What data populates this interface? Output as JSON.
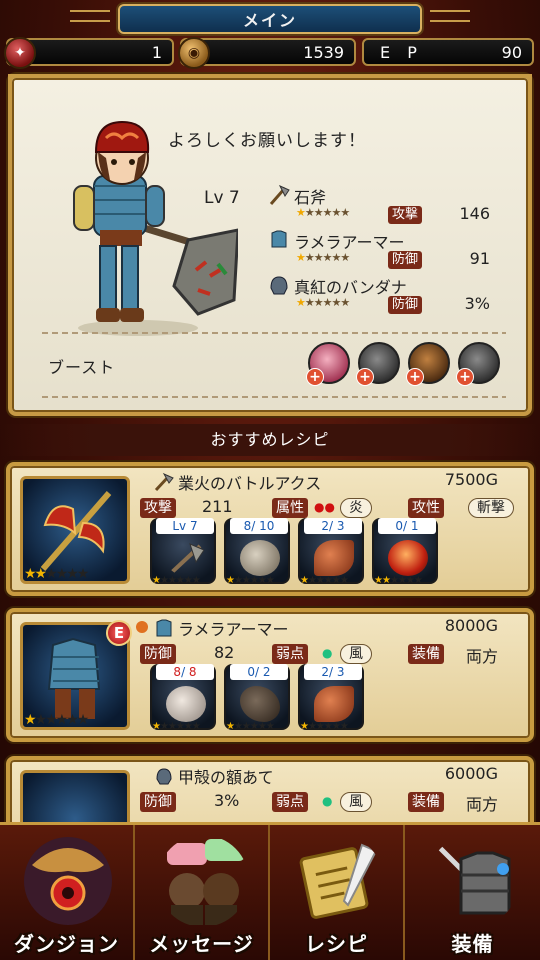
{
  "title": "メイン",
  "resources": {
    "stamina": "1",
    "gold": "1539",
    "ep_label": "E P",
    "ep": "90"
  },
  "character": {
    "greeting": "よろしくお願いします！",
    "level": "Lv  7",
    "equipment": [
      {
        "name": "石斧",
        "stat_label": "攻撃",
        "stat_value": "146",
        "rarity": 1,
        "max_rarity": 6,
        "icon": "axe-icon"
      },
      {
        "name": "ラメラアーマー",
        "stat_label": "防御",
        "stat_value": "91",
        "rarity": 1,
        "max_rarity": 6,
        "icon": "armor-icon"
      },
      {
        "name": "真紅のバンダナ",
        "stat_label": "防御",
        "stat_value": "3%",
        "rarity": 1,
        "max_rarity": 6,
        "icon": "helmet-icon"
      }
    ],
    "boost_label": "ブースト"
  },
  "section_title": "おすすめレシピ",
  "recipes": [
    {
      "name": "業火のバトルアクス",
      "price": "7500G",
      "stat_label": "攻撃",
      "stat_value": "211",
      "attr_label": "属性",
      "attr_value": "炎",
      "extra_label": "攻性",
      "extra_value": "斬撃",
      "rarity": 2,
      "materials": [
        {
          "count": "Lv 7",
          "type": "axe"
        },
        {
          "count": "8/ 10",
          "type": "rock"
        },
        {
          "count": "2/  3",
          "type": "claw"
        },
        {
          "count": "0/  1",
          "type": "orb"
        }
      ]
    },
    {
      "name": "ラメラアーマー",
      "price": "8000G",
      "stat_label": "防御",
      "stat_value": "82",
      "attr_label": "弱点",
      "attr_value": "風",
      "extra_label": "装備",
      "extra_value": "両方",
      "badge": "E",
      "rarity": 1,
      "materials": [
        {
          "have": "8",
          "need": "8",
          "type": "rock"
        },
        {
          "count": "0/  2",
          "type": "claw"
        },
        {
          "count": "2/  3",
          "type": "claw2"
        }
      ]
    },
    {
      "name": "甲殻の額あて",
      "price": "6000G",
      "stat_label": "防御",
      "stat_value": "3%",
      "attr_label": "弱点",
      "attr_value": "風",
      "extra_label": "装備",
      "extra_value": "両方"
    }
  ],
  "nav": [
    {
      "label": "ダンジョン",
      "icon": "dragon-icon"
    },
    {
      "label": "メッセージ",
      "icon": "chat-icon"
    },
    {
      "label": "レシピ",
      "icon": "scroll-icon"
    },
    {
      "label": "装備",
      "icon": "armor-icon"
    }
  ],
  "colors": {
    "frame_gold": "#c89b40",
    "tag_bg": "#7a2a18",
    "title_blue": "#1d4f78",
    "star": "#f2b400"
  }
}
